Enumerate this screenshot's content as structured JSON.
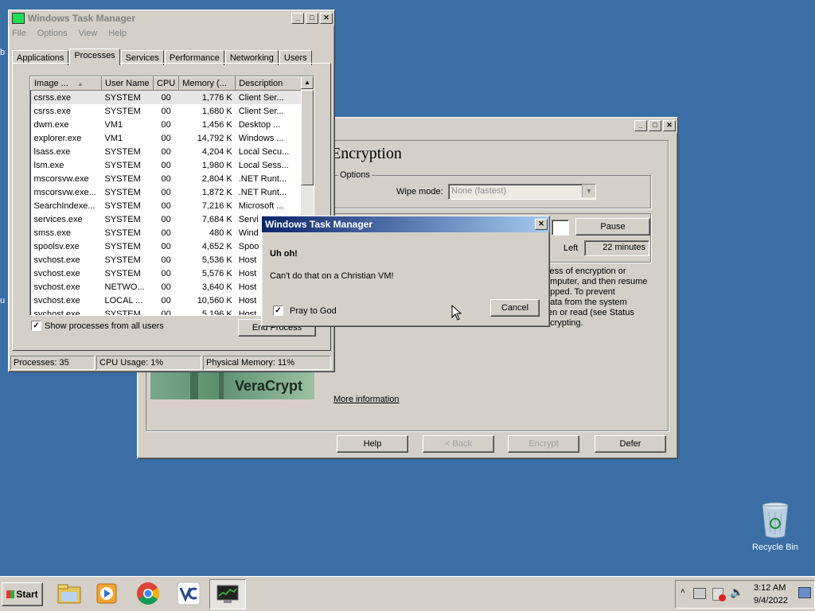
{
  "desktop": {
    "recycle_bin_label": "Recycle Bin",
    "left_edge_fragments": [
      "b",
      "u"
    ]
  },
  "task_manager": {
    "title": "Windows Task Manager",
    "menu": [
      "File",
      "Options",
      "View",
      "Help"
    ],
    "tabs": [
      "Applications",
      "Processes",
      "Services",
      "Performance",
      "Networking",
      "Users"
    ],
    "selected_tab": "Processes",
    "columns": [
      "Image ...",
      "User Name",
      "CPU",
      "Memory (...",
      "Description"
    ],
    "rows": [
      [
        "csrss.exe",
        "SYSTEM",
        "00",
        "1,776 K",
        "Client Ser..."
      ],
      [
        "csrss.exe",
        "SYSTEM",
        "00",
        "1,680 K",
        "Client Ser..."
      ],
      [
        "dwm.exe",
        "VM1",
        "00",
        "1,456 K",
        "Desktop ..."
      ],
      [
        "explorer.exe",
        "VM1",
        "00",
        "14,792 K",
        "Windows ..."
      ],
      [
        "lsass.exe",
        "SYSTEM",
        "00",
        "4,204 K",
        "Local Secu..."
      ],
      [
        "lsm.exe",
        "SYSTEM",
        "00",
        "1,980 K",
        "Local Sess..."
      ],
      [
        "mscorsvw.exe",
        "SYSTEM",
        "00",
        "2,804 K",
        ".NET Runt..."
      ],
      [
        "mscorsvw.exe...",
        "SYSTEM",
        "00",
        "1,872 K",
        ".NET Runt..."
      ],
      [
        "SearchIndexe...",
        "SYSTEM",
        "00",
        "7,216 K",
        "Microsoft ..."
      ],
      [
        "services.exe",
        "SYSTEM",
        "00",
        "7,684 K",
        "Servi"
      ],
      [
        "smss.exe",
        "SYSTEM",
        "00",
        "480 K",
        "Wind"
      ],
      [
        "spoolsv.exe",
        "SYSTEM",
        "00",
        "4,652 K",
        "Spoo"
      ],
      [
        "svchost.exe",
        "SYSTEM",
        "00",
        "5,536 K",
        "Host"
      ],
      [
        "svchost.exe",
        "SYSTEM",
        "00",
        "5,576 K",
        "Host"
      ],
      [
        "svchost.exe",
        "NETWO...",
        "00",
        "3,640 K",
        "Host"
      ],
      [
        "svchost.exe",
        "LOCAL ...",
        "00",
        "10,560 K",
        "Host"
      ],
      [
        "svchost.exe",
        "SYSTEM",
        "00",
        "5,196 K",
        "Host"
      ]
    ],
    "show_all_label": "Show processes from all users",
    "show_all_checked": true,
    "end_process_label": "End Process",
    "status_processes": "Processes: 35",
    "status_cpu": "CPU Usage: 1%",
    "status_memory": "Physical Memory: 11%"
  },
  "veracrypt": {
    "heading": "Encryption",
    "options_label": "Options",
    "wipe_mode_label": "Wipe mode:",
    "wipe_mode_value": "None (fastest)",
    "pause_label": "Pause",
    "left_label": "Left",
    "left_value": "22 minutes",
    "info_lines": [
      "cess of encryption or",
      "omputer, and then resume",
      "opped. To prevent",
      "data from the system",
      "ten or read (see Status",
      "ecrypting."
    ],
    "logo_text": "VeraCrypt",
    "more_info": "More information",
    "buttons": {
      "help": "Help",
      "back": "< Back",
      "encrypt": "Encrypt",
      "defer": "Defer"
    }
  },
  "dialog": {
    "title": "Windows Task Manager",
    "heading": "Uh oh!",
    "message": "Can't do that on a Christian VM!",
    "checkbox_label": "Pray to God",
    "checkbox_checked": true,
    "cancel_label": "Cancel"
  },
  "taskbar": {
    "start_label": "Start",
    "clock_time": "3:12 AM",
    "clock_date": "9/4/2022"
  }
}
